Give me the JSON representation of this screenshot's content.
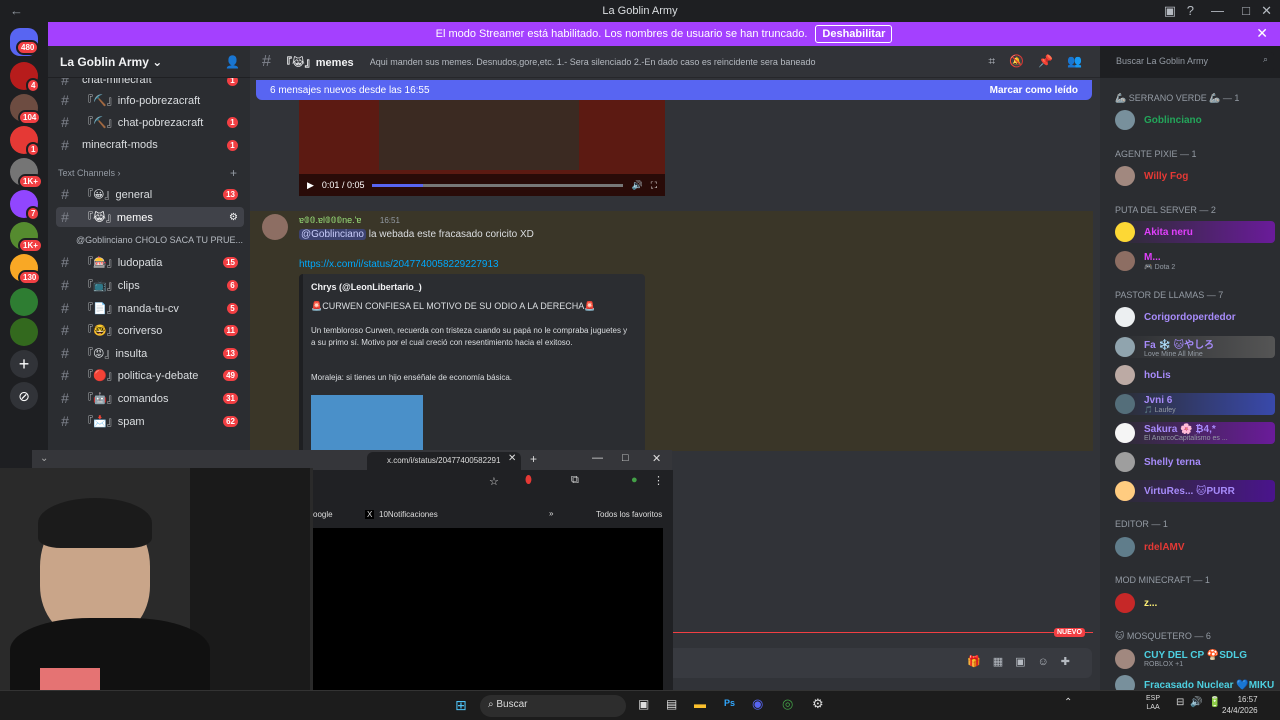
{
  "window": {
    "title": "La Goblin Army"
  },
  "banner": {
    "text": "El modo Streamer está habilitado. Los nombres de usuario se han truncado.",
    "button": "Deshabilitar"
  },
  "servers": {
    "badges": [
      "480",
      "4",
      "104",
      "1",
      "1K+",
      "7",
      "1K+",
      "130"
    ]
  },
  "sidebar": {
    "server_name": "La Goblin Army",
    "channels_top": [
      {
        "name": "chat-minecraft",
        "count": "1"
      },
      {
        "name": "『⛏️』info-pobrezacraft",
        "count": ""
      },
      {
        "name": "『⛏️』chat-pobrezacraft",
        "count": "1"
      },
      {
        "name": "minecraft-mods",
        "count": "1"
      }
    ],
    "category": "Text Channels",
    "channels": [
      {
        "name": "『😀』general",
        "count": "13"
      },
      {
        "name": "『😹』memes",
        "count": ""
      },
      {
        "name": "『🎰』ludopatia",
        "count": "15"
      },
      {
        "name": "『📺』clips",
        "count": "6"
      },
      {
        "name": "『📄』manda-tu-cv",
        "count": "5"
      },
      {
        "name": "『🤓』coriverso",
        "count": "11"
      },
      {
        "name": "『😡』insulta",
        "count": "13"
      },
      {
        "name": "『🔴』politica-y-debate",
        "count": "49"
      },
      {
        "name": "『🤖』comandos",
        "count": "31"
      },
      {
        "name": "『📩』spam",
        "count": "62"
      }
    ],
    "thread": "@Goblinciano CHOLO SACA TU PRUE..."
  },
  "channel_header": {
    "name": "『😹』memes",
    "topic": "Aqui manden sus memes. Desnudos,gore,etc. 1.- Sera silenciado 2.-En dado caso es reincidente sera baneado",
    "search_placeholder": "Buscar La Goblin Army"
  },
  "new_messages": {
    "text": "6 mensajes nuevos desde las 16:55",
    "mark": "Marcar como leído"
  },
  "video": {
    "time": "0:01 / 0:05"
  },
  "message": {
    "author": "ɐ𝟘𝟘.ɐl𝟘𝟘𝟘ne.'ɐ",
    "time": "16:51",
    "mention": "@Goblinciano",
    "text": " la webada este fracasado coricito XD",
    "link": "https://x.com/i/status/2047740058229227913"
  },
  "embed": {
    "author": "Chrys (@LeonLibertario_)",
    "title": "🚨CURWEN CONFIESA EL MOTIVO DE SU ODIO A LA DERECHA🚨",
    "body": "Un tembloroso Curwen, recuerda con tristeza cuando su papá no le compraba juguetes y a su primo sí. Motivo por el cual creció con resentimiento hacia el exitoso.",
    "moral": "Moraleja: si tienes un hijo enséñale de economía básica."
  },
  "new_badge": "NUEVO",
  "members": {
    "groups": [
      {
        "label": "🦾 Serrano verde 🦾 — 1",
        "items": [
          {
            "name": "Goblinciano",
            "color": "#23a55a",
            "sub": ""
          }
        ]
      },
      {
        "label": "Agente Pixie — 1",
        "items": [
          {
            "name": "Willy Fog",
            "color": "#e53935",
            "sub": ""
          }
        ]
      },
      {
        "label": "PUTA DEL SERVER — 2",
        "items": [
          {
            "name": "Akita neru",
            "color": "#e040fb",
            "sub": ""
          },
          {
            "name": "M...",
            "color": "#e040fb",
            "sub": "🎮 Dota 2"
          }
        ]
      },
      {
        "label": "PASTOR DE LLAMAS — 7",
        "items": [
          {
            "name": "Corigordoperdedor",
            "color": "#a78bfa",
            "sub": ""
          },
          {
            "name": "Fa ❄️ 🐱やしろ",
            "color": "#a78bfa",
            "sub": "Love Mine All Mine"
          },
          {
            "name": "hoLis",
            "color": "#a78bfa",
            "sub": ""
          },
          {
            "name": "Jvni 6",
            "color": "#a78bfa",
            "sub": "🎵 Laufey"
          },
          {
            "name": "Sakura 🌸 ₿4,*",
            "color": "#a78bfa",
            "sub": "El AnarcoCapitalismo es ..."
          },
          {
            "name": "Shelly terna",
            "color": "#a78bfa",
            "sub": ""
          },
          {
            "name": "VirtuRes... 🐱PURR",
            "color": "#a78bfa",
            "sub": ""
          }
        ]
      },
      {
        "label": "Editor — 1",
        "items": [
          {
            "name": "rdelAMV",
            "color": "#e53935",
            "sub": ""
          }
        ]
      },
      {
        "label": "Mod Minecraft — 1",
        "items": [
          {
            "name": "z...",
            "color": "#fff176",
            "sub": ""
          }
        ]
      },
      {
        "label": "🐱 Mosquetero — 6",
        "items": [
          {
            "name": "CUY DEL CP 🍄SDLG",
            "color": "#4dd0e1",
            "sub": "ROBLOX +1"
          },
          {
            "name": "Fracasado Nuclear 💙MIKU",
            "color": "#4dd0e1",
            "sub": ""
          }
        ]
      }
    ]
  },
  "chrome": {
    "tab_url": "x.com/i/status/20477400582291",
    "bookmarks": [
      "oogle",
      "10Notificaciones"
    ],
    "all_favs": "Todos los favoritos"
  },
  "taskbar": {
    "search": "Buscar",
    "lang": "ESP\nLAA",
    "time": "16:57",
    "date": "24/4/2026"
  }
}
